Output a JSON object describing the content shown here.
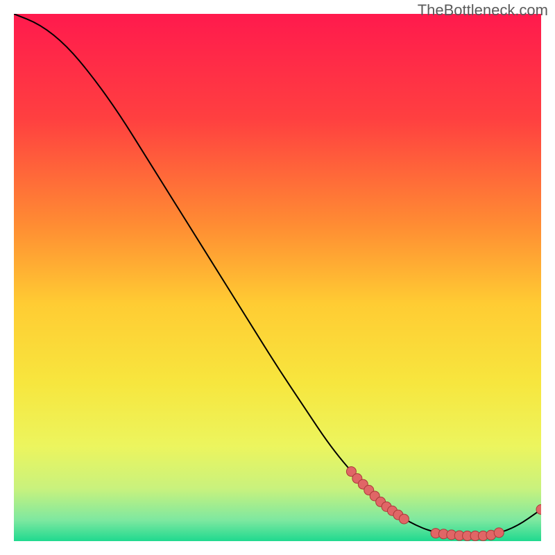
{
  "watermark": "TheBottleneck.com",
  "chart_data": {
    "type": "line",
    "title": "",
    "xlabel": "",
    "ylabel": "",
    "xlim": [
      0,
      100
    ],
    "ylim": [
      0,
      100
    ],
    "grid": false,
    "line": [
      {
        "x": 0,
        "y": 100
      },
      {
        "x": 5,
        "y": 98
      },
      {
        "x": 10,
        "y": 94
      },
      {
        "x": 15,
        "y": 88
      },
      {
        "x": 20,
        "y": 81
      },
      {
        "x": 25,
        "y": 73
      },
      {
        "x": 30,
        "y": 65
      },
      {
        "x": 35,
        "y": 57
      },
      {
        "x": 40,
        "y": 49
      },
      {
        "x": 45,
        "y": 41
      },
      {
        "x": 50,
        "y": 33
      },
      {
        "x": 55,
        "y": 25.5
      },
      {
        "x": 60,
        "y": 18
      },
      {
        "x": 65,
        "y": 12
      },
      {
        "x": 70,
        "y": 7
      },
      {
        "x": 75,
        "y": 3.5
      },
      {
        "x": 80,
        "y": 1.5
      },
      {
        "x": 85,
        "y": 1
      },
      {
        "x": 90,
        "y": 1
      },
      {
        "x": 95,
        "y": 2.5
      },
      {
        "x": 100,
        "y": 6
      }
    ],
    "marker_clusters": [
      {
        "x_start": 64,
        "x_end": 74,
        "n": 10,
        "color": "#e06666"
      },
      {
        "x_start": 80,
        "x_end": 92,
        "n": 9,
        "color": "#e06666"
      },
      {
        "x_start": 100,
        "x_end": 100,
        "n": 1,
        "color": "#e06666"
      }
    ],
    "gradient_stops": [
      {
        "offset": 0.0,
        "color": "#ff1a4d"
      },
      {
        "offset": 0.2,
        "color": "#ff4040"
      },
      {
        "offset": 0.4,
        "color": "#ff8c33"
      },
      {
        "offset": 0.55,
        "color": "#ffcc33"
      },
      {
        "offset": 0.7,
        "color": "#f7e63e"
      },
      {
        "offset": 0.82,
        "color": "#ecf55e"
      },
      {
        "offset": 0.9,
        "color": "#c9f27d"
      },
      {
        "offset": 0.96,
        "color": "#7ee8a0"
      },
      {
        "offset": 1.0,
        "color": "#1fd98f"
      }
    ],
    "line_color": "#000000",
    "marker_stroke": "#aa3a3a",
    "marker_radius": 7
  }
}
